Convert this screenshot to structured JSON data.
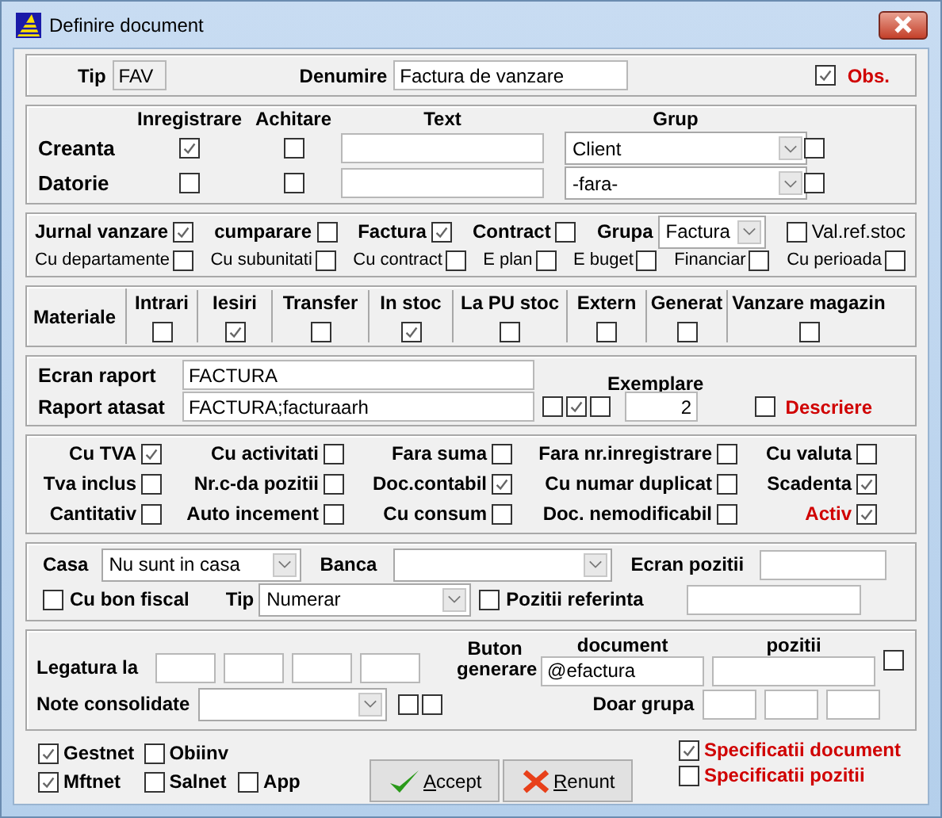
{
  "window": {
    "title": "Definire document"
  },
  "header": {
    "tip_label": "Tip",
    "tip": "FAV",
    "denumire_label": "Denumire",
    "denumire": "Factura de vanzare",
    "obs": {
      "label": "Obs.",
      "checked": true
    }
  },
  "accounts": {
    "columns": [
      "Inregistrare",
      "Achitare",
      "Text",
      "Grup"
    ],
    "rows": [
      {
        "label": "Creanta",
        "inregistrare": true,
        "achitare": false,
        "grup": "Client",
        "extra": false
      },
      {
        "label": "Datorie",
        "inregistrare": false,
        "achitare": false,
        "grup": "-fara-",
        "extra": false
      }
    ]
  },
  "jurnal": {
    "main": [
      {
        "kind": "check",
        "label": "Jurnal vanzare",
        "checked": true
      },
      {
        "kind": "check",
        "label": "cumparare",
        "checked": false
      },
      {
        "kind": "check",
        "label": "Factura",
        "checked": true
      },
      {
        "kind": "check",
        "label": "Contract",
        "checked": false
      },
      {
        "kind": "select",
        "label": "Grupa",
        "value": "Factura"
      },
      {
        "kind": "check-left",
        "label": "Val.ref.stoc",
        "checked": false
      }
    ],
    "options": [
      {
        "kind": "check",
        "label": "Cu departamente",
        "checked": false
      },
      {
        "kind": "check",
        "label": "Cu subunitati",
        "checked": false
      },
      {
        "kind": "check",
        "label": "Cu contract",
        "checked": false
      },
      {
        "kind": "check",
        "label": "E plan",
        "checked": false
      },
      {
        "kind": "check",
        "label": "E buget",
        "checked": false
      },
      {
        "kind": "check",
        "label": "Financiar",
        "checked": false
      },
      {
        "kind": "check",
        "label": "Cu perioada",
        "checked": false
      }
    ]
  },
  "materiale": {
    "label": "Materiale",
    "columns": [
      {
        "label": "Intrari",
        "checked": false
      },
      {
        "label": "Iesiri",
        "checked": true
      },
      {
        "label": "Transfer",
        "checked": false
      },
      {
        "label": "In stoc",
        "checked": true
      },
      {
        "label": "La PU stoc",
        "checked": false
      },
      {
        "label": "Extern",
        "checked": false
      },
      {
        "label": "Generat",
        "checked": false
      },
      {
        "label": "Vanzare magazin",
        "checked": false
      }
    ]
  },
  "raport": {
    "ecran_label": "Ecran raport",
    "ecran": "FACTURA",
    "atasat_label": "Raport atasat",
    "atasat": "FACTURA;facturaarh",
    "atasat_checks": [
      false,
      true,
      false
    ],
    "exemplare_label": "Exemplare",
    "exemplare": "2",
    "descriere": {
      "label": "Descriere",
      "checked": false
    }
  },
  "flags": [
    {
      "label": "Cu TVA",
      "checked": true,
      "alert": false
    },
    {
      "label": "Cu activitati",
      "checked": false,
      "alert": false
    },
    {
      "label": "Fara suma",
      "checked": false,
      "alert": false
    },
    {
      "label": "Fara nr.inregistrare",
      "checked": false,
      "alert": false
    },
    {
      "label": "Cu valuta",
      "checked": false,
      "alert": false
    },
    {
      "label": "Tva inclus",
      "checked": false,
      "alert": false
    },
    {
      "label": "Nr.c-da pozitii",
      "checked": false,
      "alert": false
    },
    {
      "label": "Doc.contabil",
      "checked": true,
      "alert": false
    },
    {
      "label": "Cu numar duplicat",
      "checked": false,
      "alert": false
    },
    {
      "label": "Scadenta",
      "checked": true,
      "alert": false
    },
    {
      "label": "Cantitativ",
      "checked": false,
      "alert": false
    },
    {
      "label": "Auto incement",
      "checked": false,
      "alert": false
    },
    {
      "label": "Cu consum",
      "checked": false,
      "alert": false
    },
    {
      "label": "Doc. nemodificabil",
      "checked": false,
      "alert": false
    },
    {
      "label": "Activ",
      "checked": true,
      "alert": true
    }
  ],
  "plata": {
    "casa_label": "Casa",
    "casa": "Nu sunt in casa",
    "banca_label": "Banca",
    "ecran_pozitii_label": "Ecran pozitii",
    "bon_fiscal": {
      "label": "Cu bon fiscal",
      "checked": false
    },
    "tip_label": "Tip",
    "tip": "Numerar",
    "pozitii_referinta": {
      "label": "Pozitii referinta",
      "checked": false
    }
  },
  "legaturi": {
    "legatura_label": "Legatura la",
    "note_label": "Note consolidate",
    "note_checks": [
      false,
      false
    ],
    "buton_label": "Buton generare",
    "document_label": "document",
    "document": "@efactura",
    "pozitii_label": "pozitii",
    "pozitii_check": false,
    "doar_grupa_label": "Doar grupa"
  },
  "modules": [
    {
      "label": "Gestnet",
      "checked": true
    },
    {
      "label": "Obiinv",
      "checked": false
    },
    {
      "label": "Mftnet",
      "checked": true
    },
    {
      "label": "Salnet",
      "checked": false
    },
    {
      "label": "App",
      "checked": false
    }
  ],
  "buttons": [
    {
      "kind": "accept",
      "label": "Accept"
    },
    {
      "kind": "cancel",
      "label": "Renunt"
    }
  ],
  "specificatii": [
    {
      "label": "Specificatii document",
      "checked": true
    },
    {
      "label": "Specificatii pozitii",
      "checked": false
    }
  ]
}
